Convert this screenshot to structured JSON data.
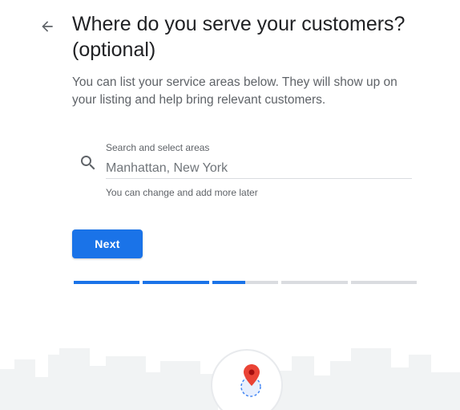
{
  "header": {
    "title": "Where do you serve your customers? (optional)",
    "subtitle": "You can list your service areas below. They will show up on your listing and help bring relevant customers."
  },
  "search": {
    "label": "Search and select areas",
    "placeholder": "Manhattan, New York",
    "value": "",
    "helper": "You can change and add more later"
  },
  "actions": {
    "next_label": "Next"
  },
  "progress": {
    "segments": 5,
    "segment_fill": [
      1,
      1,
      0.5,
      0,
      0
    ]
  },
  "icons": {
    "back": "arrow-left-icon",
    "search": "search-icon",
    "map": "map-pin-icon"
  },
  "colors": {
    "accent": "#1a73e8",
    "pin": "#ea4335",
    "track": "#dadce0",
    "skyline": "#f1f3f4"
  }
}
